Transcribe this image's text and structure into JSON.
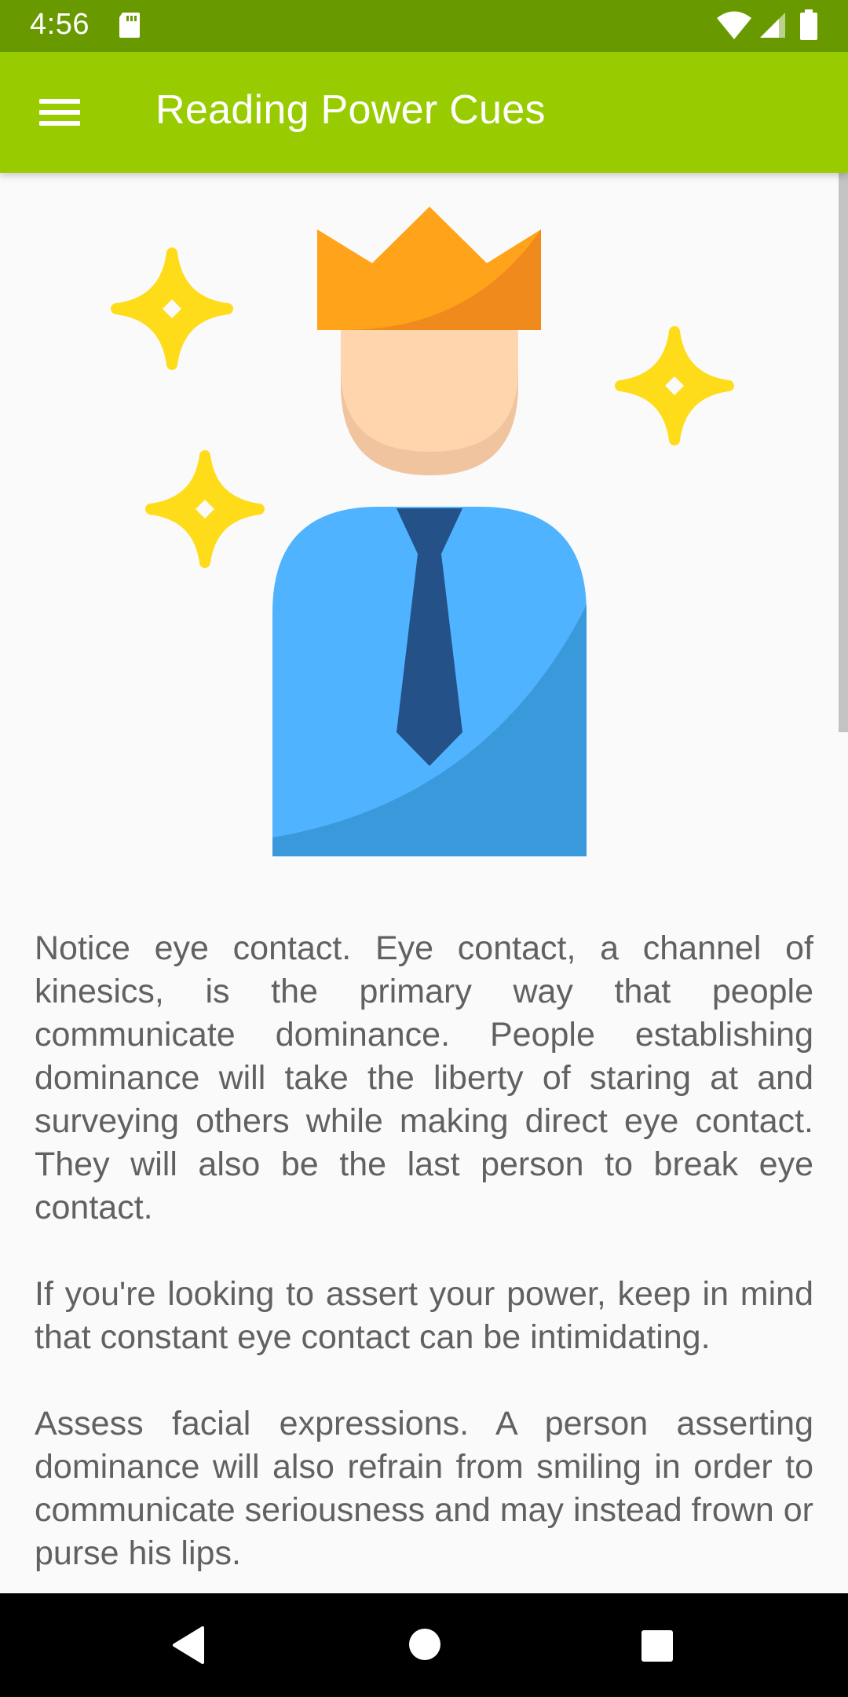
{
  "status_bar": {
    "time": "4:56",
    "icons": [
      "sd-card-icon",
      "wifi-icon",
      "cell-signal-icon",
      "battery-icon"
    ]
  },
  "app_bar": {
    "title": "Reading Power Cues",
    "menu_icon": "menu-icon"
  },
  "illustration": {
    "subject": "person with crown and tie",
    "colors": {
      "crown": "#FFA31A",
      "crown_shade": "#F08A1C",
      "face": "#FFD5AE",
      "face_shade": "#F0C49E",
      "shirt": "#4FB3FF",
      "shirt_shade": "#3A99DA",
      "tie": "#235188",
      "sparkle": "#FFDC1A"
    }
  },
  "content": {
    "paragraphs": [
      "Notice eye contact. Eye contact, a channel of kinesics, is the primary way that people communicate dominance. People establishing dominance will take the liberty of staring at and surveying others while making direct eye contact. They will also be the last person to break eye contact.",
      " If you're looking to assert your power, keep in mind that constant eye contact can be intimidating.",
      " Assess facial expressions. A person asserting dominance will also refrain from smiling in order to communicate seriousness and may instead frown or purse his lips."
    ]
  },
  "nav_bar": {
    "icons": [
      "back-icon",
      "home-icon",
      "recent-apps-icon"
    ]
  },
  "theme": {
    "status_bar": "#689A00",
    "app_bar": "#99CC00",
    "background": "#FAFAFA",
    "text": "#616161"
  }
}
